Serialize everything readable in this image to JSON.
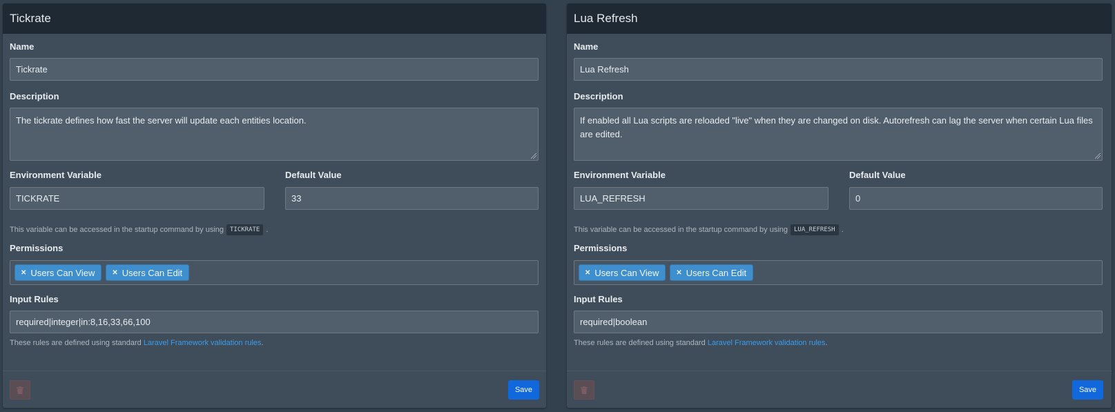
{
  "panels": [
    {
      "title": "Tickrate",
      "name_label": "Name",
      "name_value": "Tickrate",
      "description_label": "Description",
      "description_value": "The tickrate defines how fast the server will update each entities location.",
      "env_label": "Environment Variable",
      "env_value": "TICKRATE",
      "default_label": "Default Value",
      "default_value": "33",
      "help_prefix": "This variable can be accessed in the startup command by using",
      "help_code": "TICKRATE",
      "help_suffix": ".",
      "permissions_label": "Permissions",
      "permissions": [
        "Users Can View",
        "Users Can Edit"
      ],
      "input_rules_label": "Input Rules",
      "input_rules_value": "required|integer|in:8,16,33,66,100",
      "rules_help_prefix": "These rules are defined using standard",
      "rules_help_link": "Laravel Framework validation rules",
      "rules_help_suffix": ".",
      "save_label": "Save"
    },
    {
      "title": "Lua Refresh",
      "name_label": "Name",
      "name_value": "Lua Refresh",
      "description_label": "Description",
      "description_value": "If enabled all Lua scripts are reloaded \"live\" when they are changed on disk. Autorefresh can lag the server when certain Lua files are edited.",
      "env_label": "Environment Variable",
      "env_value": "LUA_REFRESH",
      "default_label": "Default Value",
      "default_value": "0",
      "help_prefix": "This variable can be accessed in the startup command by using",
      "help_code": "LUA_REFRESH",
      "help_suffix": ".",
      "permissions_label": "Permissions",
      "permissions": [
        "Users Can View",
        "Users Can Edit"
      ],
      "input_rules_label": "Input Rules",
      "input_rules_value": "required|boolean",
      "rules_help_prefix": "These rules are defined using standard",
      "rules_help_link": "Laravel Framework validation rules",
      "rules_help_suffix": ".",
      "save_label": "Save"
    }
  ],
  "icons": {
    "remove_tag": "close-icon",
    "delete": "trash-icon"
  },
  "colors": {
    "save_button": "#1068dc",
    "tag": "#3f8fcf",
    "link": "#3d9be9"
  }
}
